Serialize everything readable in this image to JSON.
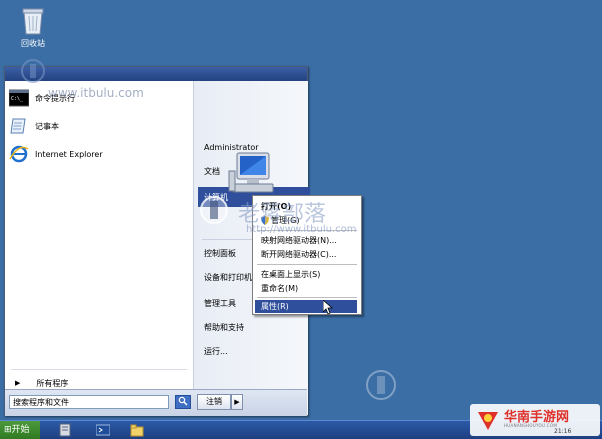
{
  "desktop": {
    "recycle_bin_label": "回收站"
  },
  "start_menu": {
    "pinned": [
      {
        "label": "命令提示行",
        "icon": "command-prompt-icon"
      },
      {
        "label": "记事本",
        "icon": "notepad-icon"
      },
      {
        "label": "Internet Explorer",
        "icon": "internet-explorer-icon"
      }
    ],
    "all_programs": "所有程序",
    "all_programs_arrow": "▶",
    "search_placeholder": "搜索程序和文件",
    "search_icon": "search-icon",
    "logoff_label": "注销",
    "logoff_arrow": "▶",
    "right_items": [
      "Administrator",
      "文档",
      "计算机",
      "控制面板",
      "设备和打印机",
      "管理工具",
      "帮助和支持",
      "运行..."
    ]
  },
  "context_menu": {
    "items": [
      {
        "label": "打开(O)"
      },
      {
        "label": "管理(G)"
      },
      {
        "label": "映射网络驱动器(N)..."
      },
      {
        "label": "断开网络驱动器(C)..."
      },
      {
        "label": "在桌面上显示(S)"
      },
      {
        "label": "重命名(M)"
      },
      {
        "label": "属性(R)"
      }
    ]
  },
  "taskbar": {
    "start_label": "开始"
  },
  "watermarks": {
    "site1": "www.itbulu.com",
    "site2": "http://www.itbulu.com",
    "brand_cn": "老蒋部落",
    "corner_brand": "华南手游网",
    "corner_site": "HUANANSHOUYOU.COM",
    "clock": "21:16"
  },
  "colors": {
    "desktop": "#3b6ea5",
    "highlight": "#2f4f9c",
    "taskbar": "#1e3f80"
  }
}
